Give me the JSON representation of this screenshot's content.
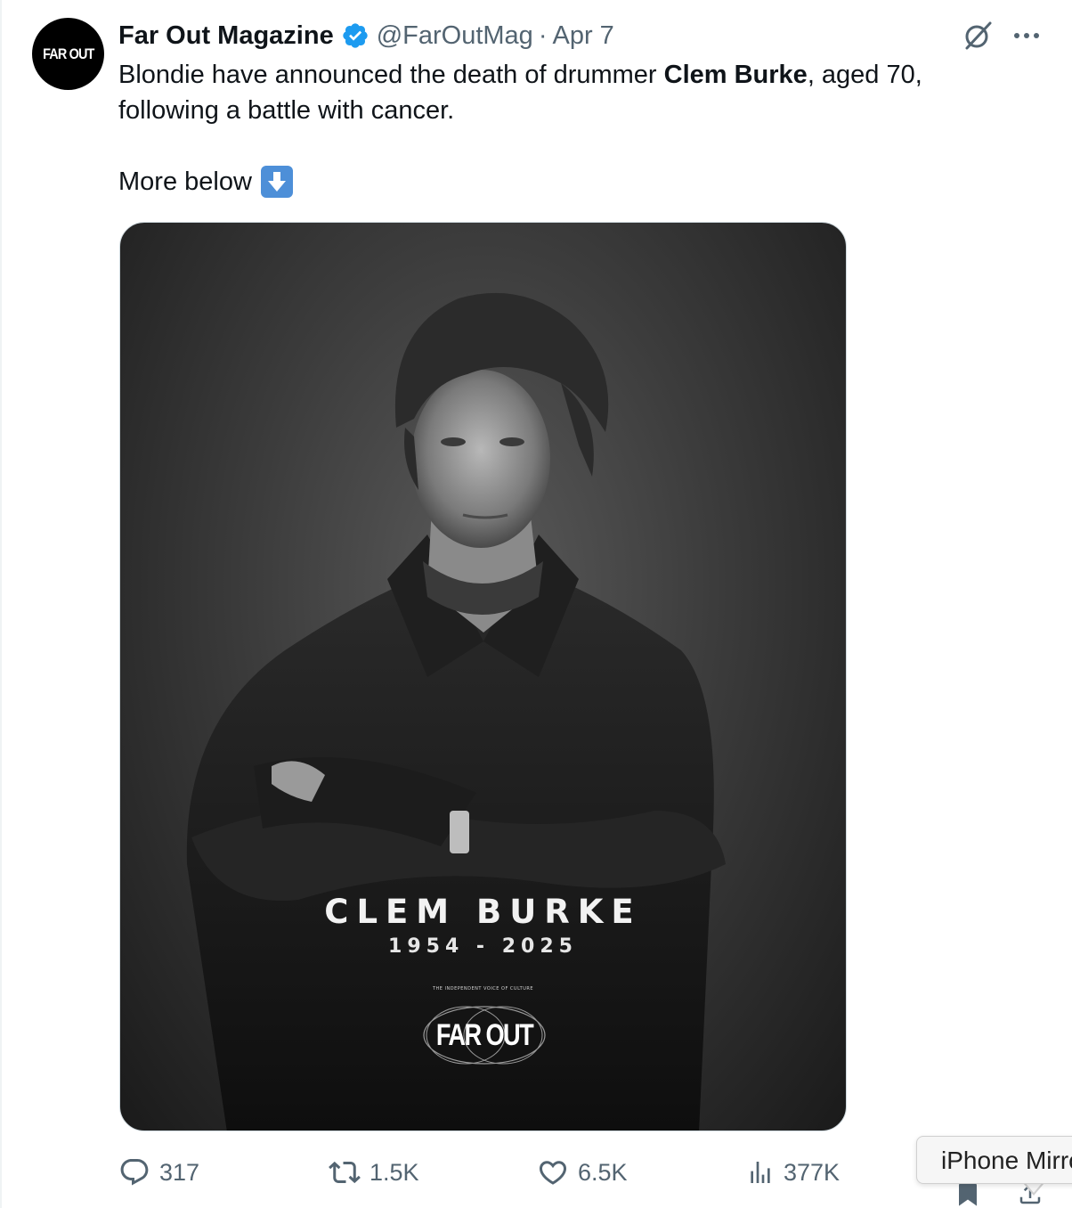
{
  "author": {
    "avatar_text": "FAR OUT",
    "display_name": "Far Out Magazine",
    "handle": "@FarOutMag",
    "separator": "·",
    "date": "Apr 7",
    "verified_color": "#1d9bf0"
  },
  "tweet": {
    "text_before": "Blondie have announced the death of drummer ",
    "text_bold": "Clem Burke",
    "text_after": ", aged 70, following a battle with cancer.",
    "more_line": "More below",
    "more_emoji": "down-arrow-emoji"
  },
  "media": {
    "poster_name": "CLEM BURKE",
    "poster_years": "1954 - 2025",
    "poster_tagline": "THE INDEPENDENT VOICE OF CULTURE",
    "poster_logo": "FAR OUT"
  },
  "actions": {
    "replies": "317",
    "reposts": "1.5K",
    "likes": "6.5K",
    "views": "377K"
  },
  "tooltip": {
    "text": "iPhone Mirroring"
  },
  "colors": {
    "text_primary": "#0f1419",
    "text_secondary": "#536471",
    "accent": "#1d9bf0"
  }
}
